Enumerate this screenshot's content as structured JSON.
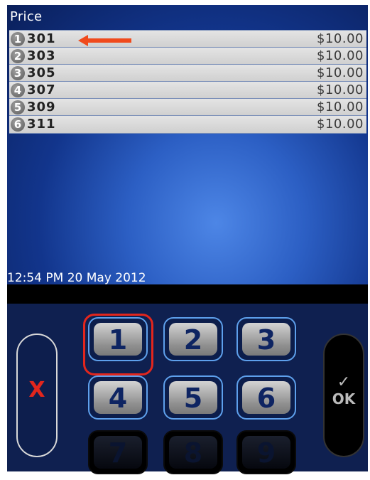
{
  "screen": {
    "title": "Price",
    "rows": [
      {
        "num": "1",
        "code": "301",
        "price": "$10.00"
      },
      {
        "num": "2",
        "code": "303",
        "price": "$10.00"
      },
      {
        "num": "3",
        "code": "305",
        "price": "$10.00"
      },
      {
        "num": "4",
        "code": "307",
        "price": "$10.00"
      },
      {
        "num": "5",
        "code": "309",
        "price": "$10.00"
      },
      {
        "num": "6",
        "code": "311",
        "price": "$10.00"
      }
    ],
    "timestamp": "12:54 PM 20 May 2012"
  },
  "keypad": {
    "keys": [
      "1",
      "2",
      "3",
      "4",
      "5",
      "6",
      "7",
      "8",
      "9"
    ],
    "cancel_label": "X",
    "ok_check": "✓",
    "ok_label": "OK"
  },
  "colors": {
    "highlight": "#e2261d",
    "screen_bg": "#2c5fc4",
    "key_border": "#5ea0ec"
  }
}
